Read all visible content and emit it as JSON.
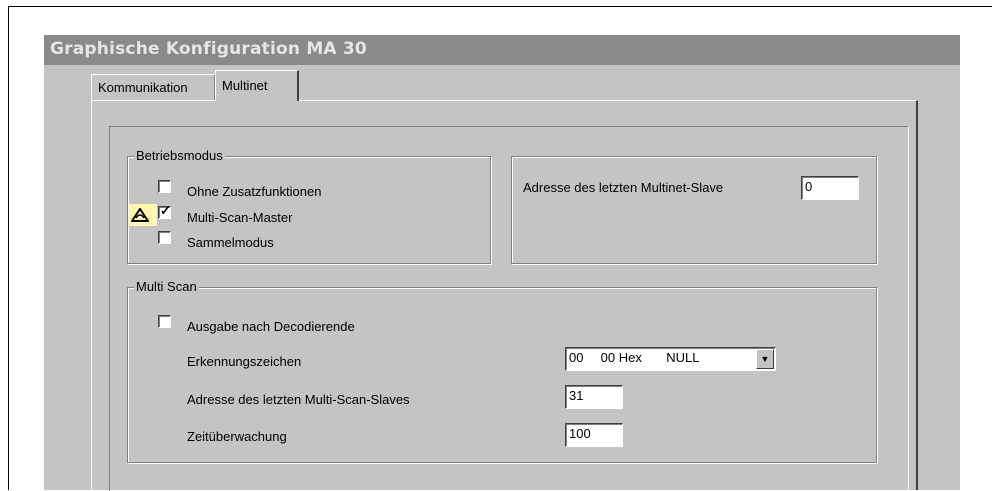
{
  "window": {
    "title": "Graphische Konfiguration MA 30"
  },
  "tabs": [
    {
      "label": "Kommunikation",
      "selected": false
    },
    {
      "label": "Multinet",
      "selected": true
    }
  ],
  "betriebsmodus": {
    "label": "Betriebsmodus",
    "options": [
      {
        "label": "Ohne Zusatzfunktionen",
        "checked": false
      },
      {
        "label": "Multi-Scan-Master",
        "checked": true,
        "icon": "warning-triangle-icon"
      },
      {
        "label": "Sammelmodus",
        "checked": false
      }
    ]
  },
  "slave_address": {
    "label": "Adresse des letzten Multinet-Slave",
    "value": "0"
  },
  "multi_scan": {
    "label": "Multi Scan",
    "ausgabe": {
      "label": "Ausgabe nach Decodierende",
      "checked": false
    },
    "erkennungszeichen": {
      "label": "Erkennungszeichen",
      "value_dec": "00",
      "value_hex": "00 Hex",
      "value_name": "NULL"
    },
    "letzter_slave": {
      "label": "Adresse des letzten Multi-Scan-Slaves",
      "value": "31"
    },
    "zeitueberwachung": {
      "label": "Zeitüberwachung",
      "value": "100"
    }
  },
  "icons": {
    "dropdown": "dropdown-arrow-icon",
    "check": "checkmark-icon"
  }
}
